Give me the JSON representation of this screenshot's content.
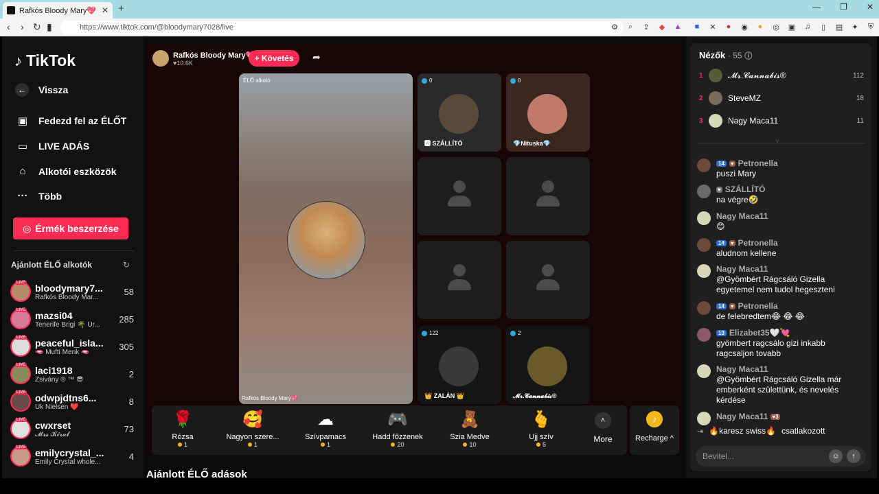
{
  "browser": {
    "tab_title": "Rafkós Bloody Mary💖 (@bl",
    "tab_close": "✕",
    "new_tab": "+",
    "url": "https://www.tiktok.com/@bloodymary7028/live",
    "win_controls": [
      "—",
      "❐",
      "✕"
    ]
  },
  "sidebar": {
    "logo": "TikTok",
    "back": "Vissza",
    "nav": [
      {
        "label": "Fedezd fel az ÉLŐT",
        "icon": "explore-live-icon"
      },
      {
        "label": "LIVE ADÁS",
        "icon": "live-camera-icon"
      },
      {
        "label": "Alkotói eszközök",
        "icon": "creator-tools-icon"
      },
      {
        "label": "Több",
        "icon": "more-dots-icon"
      }
    ],
    "coins_button": "Érmék beszerzése",
    "recommended_title": "Ajánlott ÉLŐ alkotók",
    "creators": [
      {
        "name": "bloodymary7...",
        "sub": "Rafkós Bloody Mar...",
        "count": "58"
      },
      {
        "name": "mazsi04",
        "sub": "Tenerife Brigi 🌴 Úr...",
        "count": "285"
      },
      {
        "name": "peaceful_isla...",
        "sub": "🫦 Mufti Menk 🫦",
        "count": "305"
      },
      {
        "name": "laci1918",
        "sub": "Zsivány ® ™ 😎",
        "count": "2"
      },
      {
        "name": "odwpjdtns6...",
        "sub": "Uk Nielsen ❤️",
        "count": "8"
      },
      {
        "name": "cwxrset",
        "sub": "𝓜𝓻𝓼 𝓚𝓲𝓻𝓪𝓵",
        "count": "73"
      },
      {
        "name": "emilycrystal_...",
        "sub": "Emily Crystal whole...",
        "count": "4"
      }
    ]
  },
  "stream": {
    "host_name": "Rafkós Bloody Mary💖",
    "host_likes": "♥10.6K",
    "follow": "+ Követés",
    "main_label": "ÉLŐ alkotó",
    "main_caption": "Rafkós Bloody Mary💖",
    "tiles": [
      {
        "badge": "0",
        "label": "🅰 SZÁLLÍTÓ"
      },
      {
        "badge": "0",
        "label": "💎Nituska💎"
      },
      {
        "badge": "",
        "label": ""
      },
      {
        "badge": "",
        "label": ""
      },
      {
        "badge": "",
        "label": ""
      },
      {
        "badge": "",
        "label": ""
      },
      {
        "badge": "122",
        "label": "👑 ZALÁN 👑"
      },
      {
        "badge": "2",
        "label": "𝓜𝓻.𝓒𝓪𝓷𝓷𝓪𝓫𝓲𝓼®"
      }
    ],
    "gifts": [
      {
        "icon": "🌹",
        "name": "Rózsa",
        "price": "1"
      },
      {
        "icon": "🥰",
        "name": "Nagyon szere...",
        "price": "1"
      },
      {
        "icon": "☁",
        "name": "Szívpamacs",
        "price": "1"
      },
      {
        "icon": "🎮",
        "name": "Hadd főzzenek",
        "price": "20"
      },
      {
        "icon": "🧸",
        "name": "Szia Medve",
        "price": "10"
      },
      {
        "icon": "🫰",
        "name": "Ujj szív",
        "price": "5"
      }
    ],
    "more": "More",
    "recharge": "Recharge ^",
    "recommended_live": "Ajánlott ÉLŐ adások"
  },
  "chat": {
    "viewers_title": "Nézők",
    "viewers_count": "· 55",
    "top_viewers": [
      {
        "rank": "1",
        "name": "𝓜𝓻.𝓒𝓪𝓷𝓷𝓪𝓫𝓲𝓼®",
        "score": "112"
      },
      {
        "rank": "2",
        "name": "SteveMZ",
        "score": "18"
      },
      {
        "rank": "3",
        "name": "Nagy Maca11",
        "score": "11"
      }
    ],
    "messages": [
      {
        "user": "Petronella",
        "level": "14",
        "text": "puszi Mary"
      },
      {
        "user": "SZÁLLÍTÓ",
        "level": "",
        "text": "na végre🤣"
      },
      {
        "user": "Nagy Maca11",
        "level": "",
        "text": "😊"
      },
      {
        "user": "Petronella",
        "level": "14",
        "text": "aludnom kellene"
      },
      {
        "user": "Nagy Maca11",
        "level": "",
        "text": "@Gyömbért Rágcsáló Gizella egyetemel nem tudol hegeszteni"
      },
      {
        "user": "Petronella",
        "level": "14",
        "text": "de felebredtem😂 😂 😂"
      },
      {
        "user": "Elizabet35🤍💘",
        "level": "13",
        "text": "gyömbert ragcsálo gizi inkabb ragcsaljon tovabb"
      },
      {
        "user": "Nagy Maca11",
        "level": "",
        "text": "@Gyömbért Rágcsáló Gizella már emberként születtünk, és nevelés kérdése"
      },
      {
        "user": "Nagy Maca11",
        "level": "",
        "text": ""
      }
    ],
    "join_text": "🔥karesz swiss🔥",
    "join_suffix": "csatlakozott",
    "input_placeholder": "Bevitel..."
  }
}
